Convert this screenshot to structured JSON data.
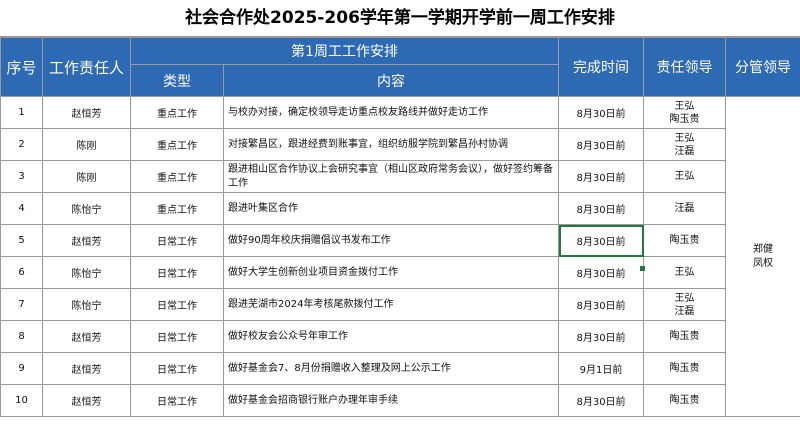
{
  "title": "社会合作处2025-206学年第一学期开学前一周工作安排",
  "headers": {
    "xuhao": "序号",
    "zerenren": "工作责任人",
    "group": "第1周工工作安排",
    "leixing": "类型",
    "neirong": "内容",
    "shijian": "完成时间",
    "lingdao": "责任领导",
    "fenguan": "分管领导"
  },
  "fenguan_leaders": [
    "郑健",
    "凤权"
  ],
  "rows": [
    {
      "no": "1",
      "person": "赵恒芳",
      "type": "重点工作",
      "content": "与校办对接，确定校领导走访重点校友路线并做好走访工作",
      "time": "8月30日前",
      "leaders": [
        "王弘",
        "陶玉贵"
      ]
    },
    {
      "no": "2",
      "person": "陈刚",
      "type": "重点工作",
      "content": "对接繁昌区，跟进经费到账事宜，组织纺服学院到繁昌孙村协调",
      "time": "8月30日前",
      "leaders": [
        "王弘",
        "汪磊"
      ]
    },
    {
      "no": "3",
      "person": "陈刚",
      "type": "重点工作",
      "content": "跟进相山区合作协议上会研究事宜（相山区政府常务会议），做好签约筹备工作",
      "time": "8月30日前",
      "leaders": [
        "王弘"
      ]
    },
    {
      "no": "4",
      "person": "陈怡宁",
      "type": "重点工作",
      "content": "跟进叶集区合作",
      "time": "8月30日前",
      "leaders": [
        "汪磊"
      ]
    },
    {
      "no": "5",
      "person": "赵恒芳",
      "type": "日常工作",
      "content": "做好90周年校庆捐赠倡议书发布工作",
      "time": "8月30日前",
      "leaders": [
        "陶玉贵"
      ]
    },
    {
      "no": "6",
      "person": "陈怡宁",
      "type": "日常工作",
      "content": "做好大学生创新创业项目资金拨付工作",
      "time": "8月30日前",
      "leaders": [
        "王弘"
      ]
    },
    {
      "no": "7",
      "person": "陈怡宁",
      "type": "日常工作",
      "content": "跟进芜湖市2024年考核尾款拨付工作",
      "time": "8月30日前",
      "leaders": [
        "王弘",
        "汪磊"
      ]
    },
    {
      "no": "8",
      "person": "赵恒芳",
      "type": "日常工作",
      "content": "做好校友会公众号年审工作",
      "time": "8月30日前",
      "leaders": [
        "陶玉贵"
      ]
    },
    {
      "no": "9",
      "person": "赵恒芳",
      "type": "日常工作",
      "content": "做好基金会7、8月份捐赠收入整理及网上公示工作",
      "time": "9月1日前",
      "leaders": [
        "陶玉贵"
      ]
    },
    {
      "no": "10",
      "person": "赵恒芳",
      "type": "日常工作",
      "content": "做好基金会招商银行账户办理年审手续",
      "time": "8月30日前",
      "leaders": [
        "陶玉贵"
      ]
    }
  ]
}
